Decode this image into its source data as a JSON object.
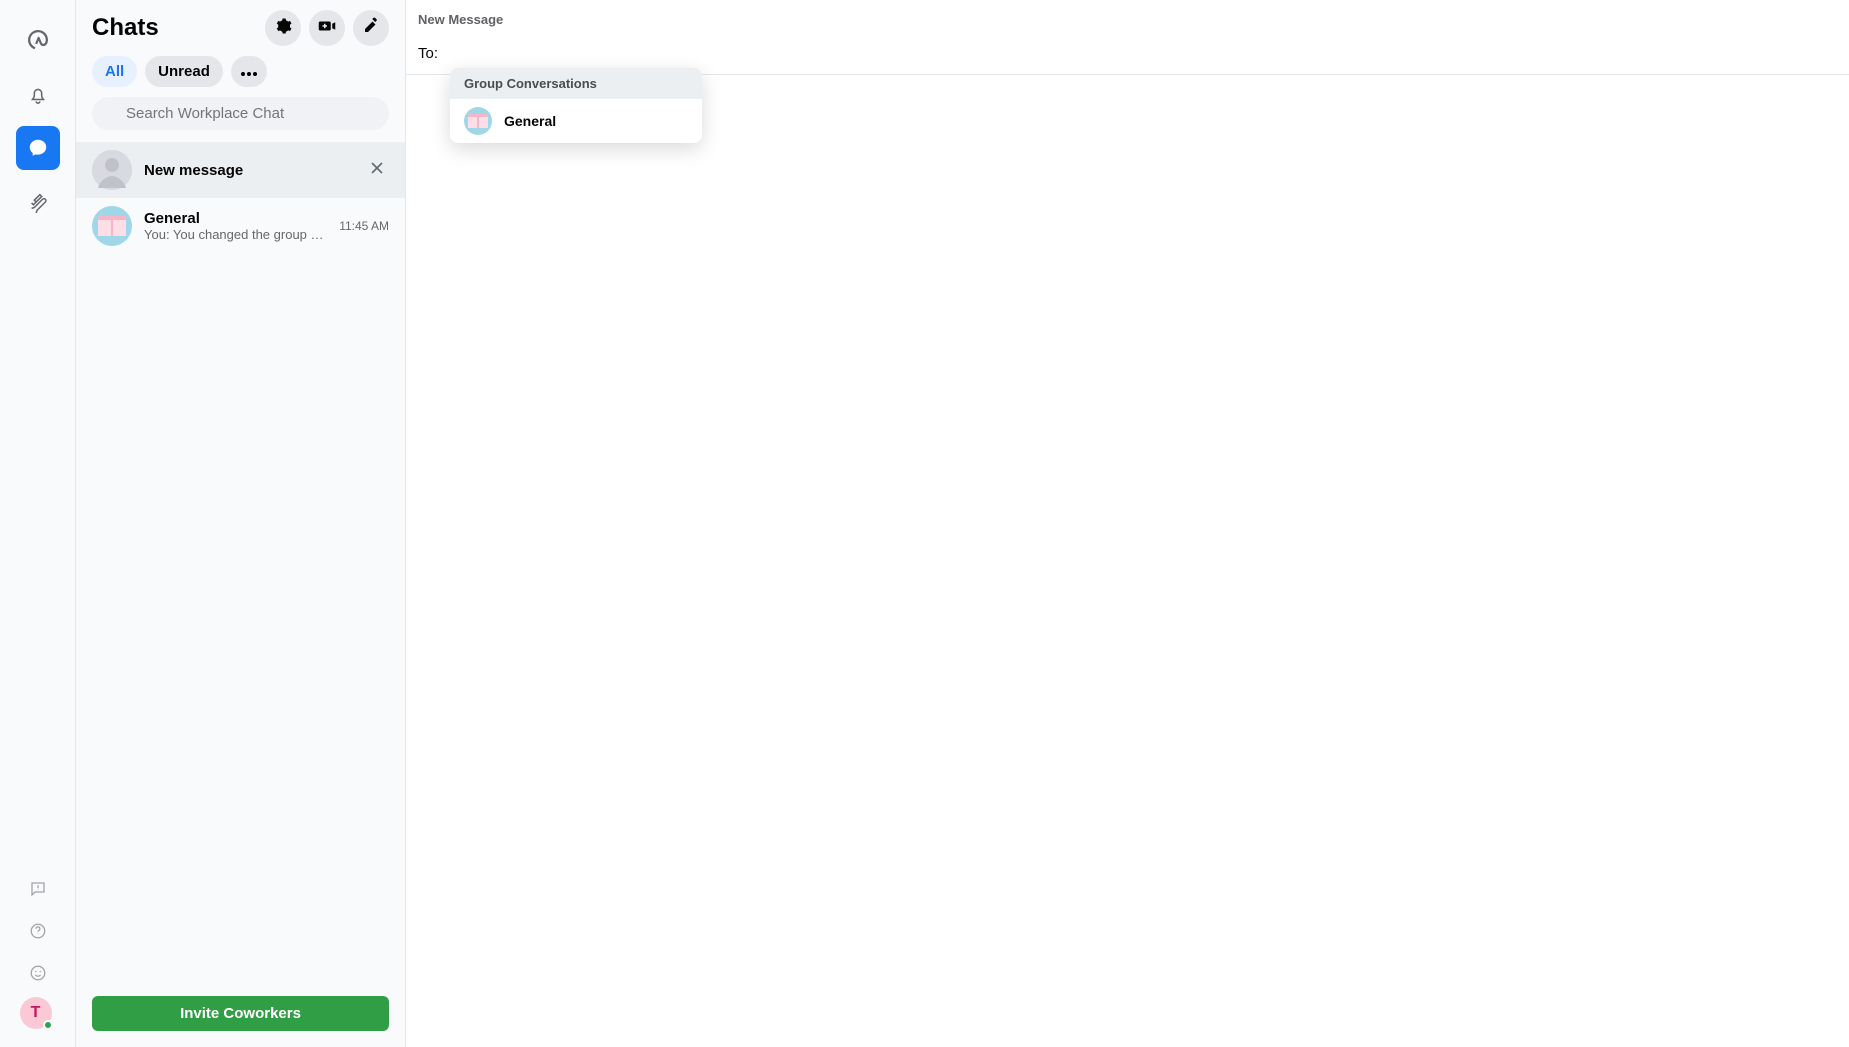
{
  "rail": {
    "avatar_letter": "T"
  },
  "sidebar": {
    "title": "Chats",
    "filters": {
      "all": "All",
      "unread": "Unread"
    },
    "search_placeholder": "Search Workplace Chat",
    "threads": [
      {
        "title": "New message"
      },
      {
        "title": "General",
        "subtitle": "You: You changed the group photo.",
        "time": "11:45 AM"
      }
    ],
    "invite_label": "Invite Coworkers"
  },
  "main": {
    "new_msg_title": "New Message",
    "to_label": "To:",
    "suggestions": {
      "group_header": "Group Conversations",
      "items": [
        {
          "label": "General"
        }
      ]
    }
  }
}
